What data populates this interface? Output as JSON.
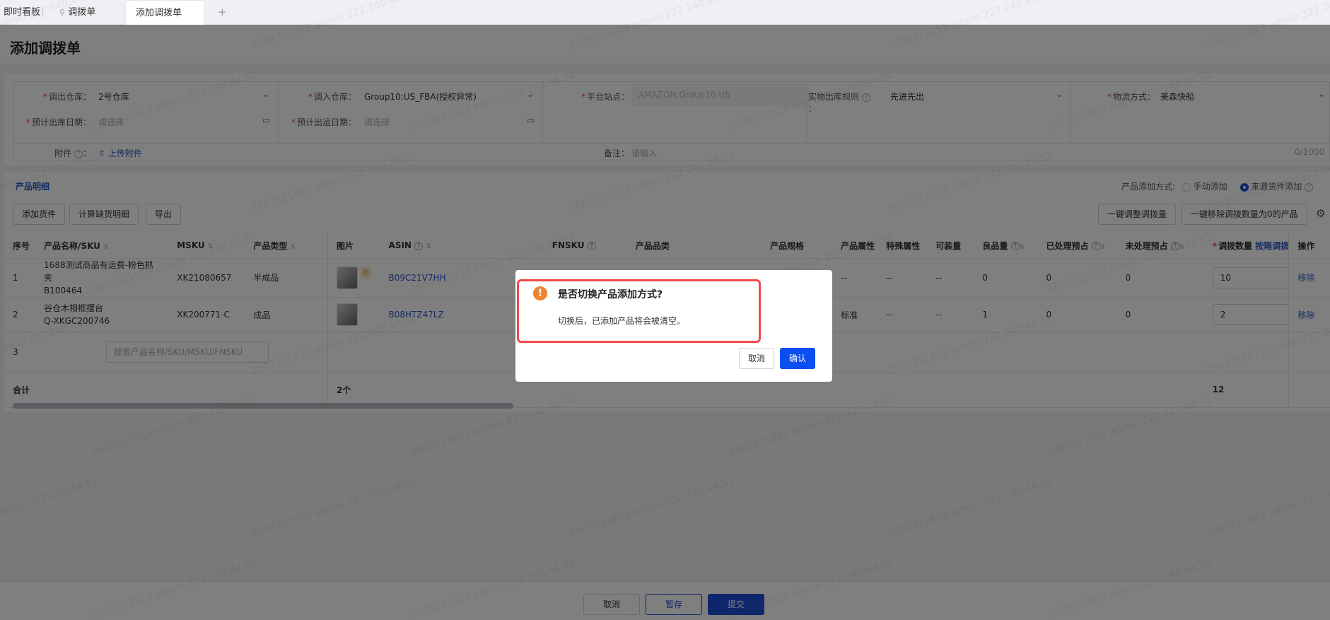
{
  "tabs": [
    {
      "label": "即时看板"
    },
    {
      "label": "调拨单"
    },
    {
      "label": "添加调拨单"
    }
  ],
  "tab_add": "+",
  "page_title": "添加调拨单",
  "form": {
    "out_wh": {
      "label": "调出仓库：",
      "value": "2号仓库"
    },
    "in_wh": {
      "label": "调入仓库：",
      "value": "Group10:US_FBA(授权异常)"
    },
    "site": {
      "label": "平台站点：",
      "value": "AMAZON:Group10:US"
    },
    "rule": {
      "label": "实物出库规则",
      "colon": "：",
      "value": "先进先出"
    },
    "logistics": {
      "label": "物流方式：",
      "value": "美森快船"
    },
    "out_date": {
      "label": "预计出库日期：",
      "placeholder": "请选择"
    },
    "ship_date": {
      "label": "预计出运日期：",
      "placeholder": "请选择"
    },
    "attach": {
      "label": "附件",
      "colon": "：",
      "upload": "上传附件"
    },
    "remark": {
      "label": "备注：",
      "placeholder": "请输入",
      "counter": "0/1000"
    }
  },
  "product": {
    "section_title": "产品明细",
    "add_mode_label": "产品添加方式:",
    "mode_manual": "手动添加",
    "mode_source": "来源货件添加",
    "mode_selected": "来源货件添加",
    "buttons": {
      "add": "添加货件",
      "calc": "计算缺货明细",
      "export": "导出",
      "adjust": "一键调整调拨量",
      "remove_zero": "一键移除调拨数量为0的产品"
    }
  },
  "table": {
    "headers": [
      "序号",
      "产品名称/SKU",
      "MSKU",
      "产品类型",
      "图片",
      "ASIN",
      "FNSKU",
      "产品品类",
      "产品规格",
      "产品属性",
      "特殊属性",
      "可装量",
      "良品量",
      "已处理预占",
      "未处理预占",
      "调拨数量",
      "操作"
    ],
    "qty_link": "按箱调拨",
    "rows": [
      {
        "no": "1",
        "name": "1688测试商品有运费-粉色抓夹",
        "sku": "B100464",
        "msku": "XK21080657",
        "type": "半成品",
        "badge": "半",
        "asin": "B09C21V7HH",
        "category": "",
        "spec": "",
        "attr": "--",
        "special": "--",
        "capacity": "--",
        "good": "0",
        "processed": "0",
        "unprocessed": "0",
        "qty": "10",
        "action": "移除"
      },
      {
        "no": "2",
        "name": "谷仓木相框摆台",
        "sku": "Q-XKGC200746",
        "msku": "XK200771-C",
        "type": "成品",
        "asin": "B08HTZ47LZ",
        "category": "",
        "spec": "",
        "attr": "标准",
        "special": "--",
        "capacity": "--",
        "good": "1",
        "processed": "0",
        "unprocessed": "0",
        "qty": "2",
        "action": "移除"
      }
    ],
    "new_row_no": "3",
    "search_placeholder": "搜索产品名称/SKU/MSKU/FNSKU",
    "total_label": "合计",
    "total_images": "2个",
    "total_qty": "12"
  },
  "footer": {
    "cancel": "取消",
    "draft": "暂存",
    "submit": "提交"
  },
  "dialog": {
    "title": "是否切换产品添加方式?",
    "message": "切换后，已添加产品将会被清空。",
    "cancel": "取消",
    "confirm": "确认"
  },
  "watermark": "2603311813 admin 222.240.44.51",
  "colors": {
    "primary": "#0b4ff0",
    "warning": "#f0832f",
    "highlight": "#ef4a4a",
    "link": "#2a56c6"
  }
}
